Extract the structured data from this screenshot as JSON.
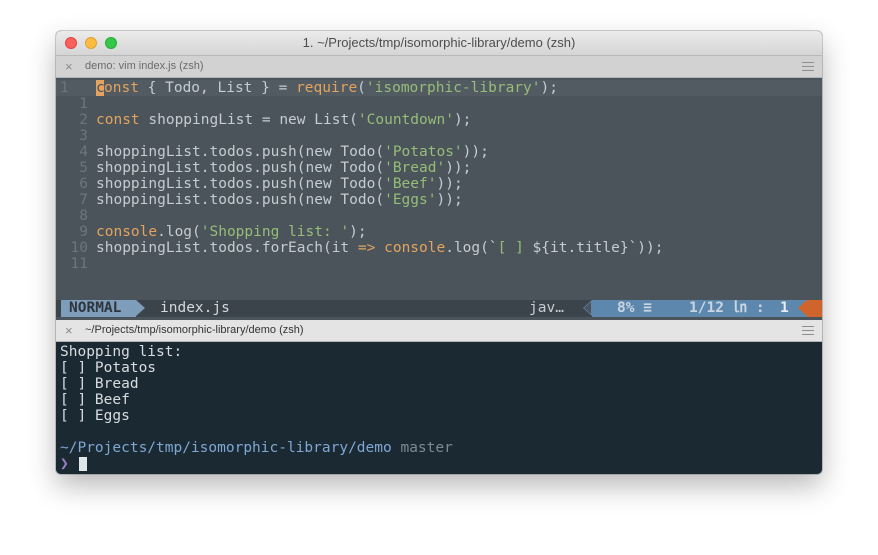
{
  "window": {
    "title": "1. ~/Projects/tmp/isomorphic-library/demo (zsh)"
  },
  "panes": {
    "top": {
      "title": "demo: vim index.js (zsh)",
      "close": "×"
    },
    "bottom": {
      "title": "~/Projects/tmp/isomorphic-library/demo (zsh)",
      "close": "×"
    }
  },
  "editor": {
    "lines": [
      {
        "num": "1",
        "tokens": [
          [
            "kw",
            "const"
          ],
          [
            "plain",
            " { Todo, List } = "
          ],
          [
            "kw",
            "require"
          ],
          [
            "plain",
            "("
          ],
          [
            "str",
            "'isomorphic-library'"
          ],
          [
            "plain",
            ");"
          ]
        ]
      },
      {
        "num": "1",
        "tokens": []
      },
      {
        "num": "2",
        "tokens": [
          [
            "kw",
            "const"
          ],
          [
            "plain",
            " shoppingList = new List("
          ],
          [
            "str",
            "'Countdown'"
          ],
          [
            "plain",
            ");"
          ]
        ]
      },
      {
        "num": "3",
        "tokens": []
      },
      {
        "num": "4",
        "tokens": [
          [
            "plain",
            "shoppingList.todos.push(new Todo("
          ],
          [
            "str",
            "'Potatos'"
          ],
          [
            "plain",
            "));"
          ]
        ]
      },
      {
        "num": "5",
        "tokens": [
          [
            "plain",
            "shoppingList.todos.push(new Todo("
          ],
          [
            "str",
            "'Bread'"
          ],
          [
            "plain",
            "));"
          ]
        ]
      },
      {
        "num": "6",
        "tokens": [
          [
            "plain",
            "shoppingList.todos.push(new Todo("
          ],
          [
            "str",
            "'Beef'"
          ],
          [
            "plain",
            "));"
          ]
        ]
      },
      {
        "num": "7",
        "tokens": [
          [
            "plain",
            "shoppingList.todos.push(new Todo("
          ],
          [
            "str",
            "'Eggs'"
          ],
          [
            "plain",
            "));"
          ]
        ]
      },
      {
        "num": "8",
        "tokens": []
      },
      {
        "num": "9",
        "tokens": [
          [
            "kw",
            "console"
          ],
          [
            "plain",
            ".log("
          ],
          [
            "str",
            "'Shopping list: '"
          ],
          [
            "plain",
            ");"
          ]
        ]
      },
      {
        "num": "10",
        "tokens": [
          [
            "plain",
            "shoppingList.todos.forEach(it "
          ],
          [
            "kw",
            "=>"
          ],
          [
            "plain",
            " "
          ],
          [
            "kw",
            "console"
          ],
          [
            "plain",
            ".log(`"
          ],
          [
            "str",
            "[ ]"
          ],
          [
            "plain",
            " ${it.title}`));"
          ]
        ]
      },
      {
        "num": "11",
        "tokens": []
      }
    ]
  },
  "statusline": {
    "mode": "NORMAL",
    "filename": "index.js",
    "filetype": "jav…",
    "percent": "8% ≡",
    "position": "1/12 ㏑ :",
    "column": "1"
  },
  "shell": {
    "output": [
      "Shopping list:",
      "[ ] Potatos",
      "[ ] Bread",
      "[ ] Beef",
      "[ ] Eggs"
    ],
    "cwd": "~/Projects/tmp/isomorphic-library/demo",
    "branch": "master",
    "prompt": "❯"
  },
  "colors": {
    "keyword": "#e3a45f",
    "string": "#96be78",
    "mode_bg": "#7d9dbb",
    "path": "#7ea7d4"
  }
}
